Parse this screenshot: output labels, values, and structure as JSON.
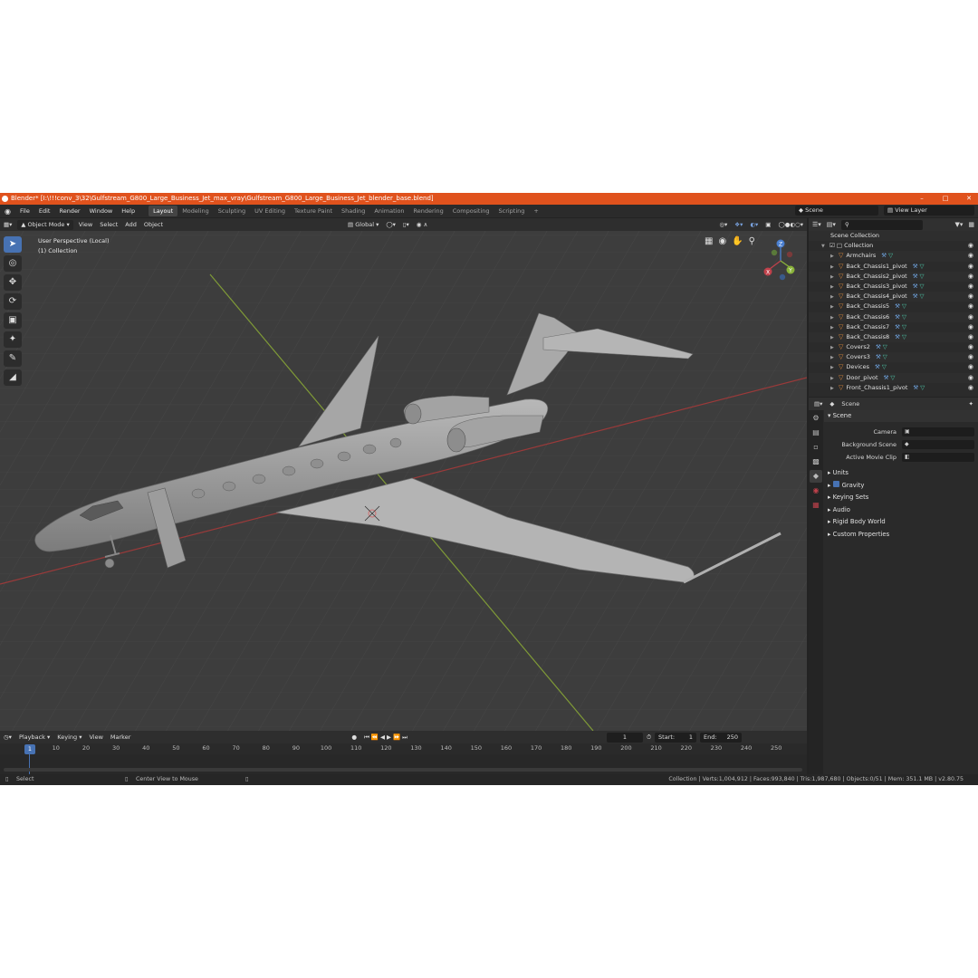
{
  "window": {
    "title": "Blender* [I:\\!!!conv_3\\32\\Gulfstream_G800_Large_Business_Jet_max_vray\\Gulfstream_G800_Large_Business_Jet_blender_base.blend]",
    "controls": [
      "–",
      "□",
      "✕"
    ]
  },
  "menubar": {
    "menus": [
      "File",
      "Edit",
      "Render",
      "Window",
      "Help"
    ],
    "workspaces": [
      "Layout",
      "Modeling",
      "Sculpting",
      "UV Editing",
      "Texture Paint",
      "Shading",
      "Animation",
      "Rendering",
      "Compositing",
      "Scripting"
    ],
    "add_tab": "+",
    "scene": "Scene",
    "view_layer": "View Layer"
  },
  "viewport": {
    "mode": "Object Mode",
    "menus": [
      "View",
      "Select",
      "Add",
      "Object"
    ],
    "orientation": "Global",
    "perspective": "User Perspective (Local)",
    "collection": "(1) Collection",
    "gizmo": {
      "x": "X",
      "y": "Y",
      "z": "Z"
    }
  },
  "timeline": {
    "menus": [
      "Playback",
      "Keying",
      "View",
      "Marker"
    ],
    "current_frame": "1",
    "start_label": "Start:",
    "start": "1",
    "end_label": "End:",
    "end": "250",
    "ticks": [
      "10",
      "20",
      "30",
      "40",
      "50",
      "60",
      "70",
      "80",
      "90",
      "100",
      "110",
      "120",
      "130",
      "140",
      "150",
      "160",
      "170",
      "180",
      "190",
      "200",
      "210",
      "220",
      "230",
      "240",
      "250"
    ],
    "cursor_label": "1"
  },
  "statusbar": {
    "select": "Select",
    "center_view": "Center View to Mouse",
    "stats": "Collection | Verts:1,004,912 | Faces:993,840 | Tris:1,987,680 | Objects:0/51 | Mem: 351.1 MB | v2.80.75"
  },
  "outliner": {
    "scene_collection": "Scene Collection",
    "collection": "Collection",
    "items": [
      {
        "name": "Armchairs",
        "mods": 1
      },
      {
        "name": "Back_Chassis1_pivot",
        "mods": 1
      },
      {
        "name": "Back_Chassis2_pivot",
        "mods": 1
      },
      {
        "name": "Back_Chassis3_pivot",
        "mods": 1
      },
      {
        "name": "Back_Chassis4_pivot",
        "mods": 1
      },
      {
        "name": "Back_Chassis5",
        "mods": 1
      },
      {
        "name": "Back_Chassis6",
        "mods": 1
      },
      {
        "name": "Back_Chassis7",
        "mods": 1
      },
      {
        "name": "Back_Chassis8",
        "mods": 1
      },
      {
        "name": "Covers2",
        "mods": 1
      },
      {
        "name": "Covers3",
        "mods": 1
      },
      {
        "name": "Devices",
        "mods": 1
      },
      {
        "name": "Door_pivot",
        "mods": 1
      },
      {
        "name": "Front_Chassis1_pivot",
        "mods": 1
      }
    ]
  },
  "properties": {
    "header": "Scene",
    "panel": "Scene",
    "rows": [
      {
        "label": "Camera",
        "value": ""
      },
      {
        "label": "Background Scene",
        "value": ""
      },
      {
        "label": "Active Movie Clip",
        "value": ""
      }
    ],
    "subpanels": [
      "Units",
      "Gravity",
      "Keying Sets",
      "Audio",
      "Rigid Body World",
      "Custom Properties"
    ]
  },
  "colors": {
    "titlebar": "#e0521d",
    "accent": "#4772b3",
    "x_axis": "#b03a3a",
    "y_axis": "#8aa63a"
  }
}
